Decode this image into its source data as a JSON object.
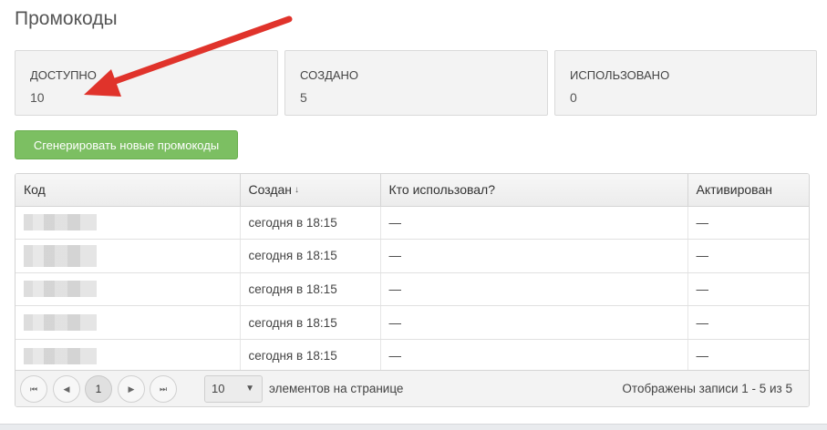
{
  "page": {
    "title": "Промокоды"
  },
  "stats": [
    {
      "label": "ДОСТУПНО",
      "value": "10"
    },
    {
      "label": "СОЗДАНО",
      "value": "5"
    },
    {
      "label": "ИСПОЛЬЗОВАНО",
      "value": "0"
    }
  ],
  "actions": {
    "generate_label": "Сгенерировать новые промокоды"
  },
  "table": {
    "columns": [
      "Код",
      "Создан",
      "Кто использовал?",
      "Активирован"
    ],
    "sort_icon": "↓",
    "rows": [
      {
        "created": "сегодня в 18:15",
        "used_by": "—",
        "activated": "—"
      },
      {
        "created": "сегодня в 18:15",
        "used_by": "—",
        "activated": "—"
      },
      {
        "created": "сегодня в 18:15",
        "used_by": "—",
        "activated": "—"
      },
      {
        "created": "сегодня в 18:15",
        "used_by": "—",
        "activated": "—"
      },
      {
        "created": "сегодня в 18:15",
        "used_by": "—",
        "activated": "—"
      }
    ]
  },
  "pager": {
    "first_icon": "⏮",
    "prev_icon": "◀",
    "current_page": "1",
    "next_icon": "▶",
    "last_icon": "⏭",
    "page_size": "10",
    "page_size_caret": "▼",
    "page_size_label": "элементов на странице",
    "records_info": "Отображены записи 1 - 5 из 5"
  },
  "colors": {
    "accent_green": "#7cbf62",
    "arrow_red": "#e0332b"
  }
}
